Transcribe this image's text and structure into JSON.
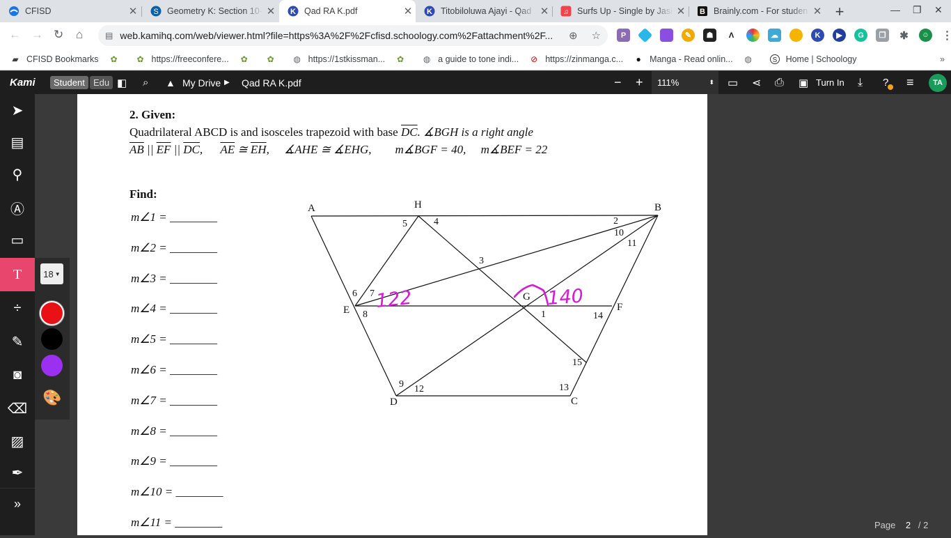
{
  "browser": {
    "tabs": [
      {
        "title": "CFISD",
        "active": false,
        "favicon": "cfisd-icon",
        "color": "#1a73e8"
      },
      {
        "title": "Geometry K: Section 10-",
        "active": false,
        "favicon": "schoology-icon",
        "color": "#0b5ea8"
      },
      {
        "title": "Qad RA K.pdf",
        "active": true,
        "favicon": "kami-icon",
        "color": "#2d4bb0"
      },
      {
        "title": "Titobiloluwa Ajayi - Qad",
        "active": false,
        "favicon": "kami-icon",
        "color": "#2d4bb0"
      },
      {
        "title": "Surfs Up - Single by Jasi",
        "active": false,
        "favicon": "music-icon",
        "color": "#f2434b"
      },
      {
        "title": "Brainly.com - For studen",
        "active": false,
        "favicon": "brainly-icon",
        "color": "#111"
      }
    ],
    "url": "web.kamihq.com/web/viewer.html?file=https%3A%2F%2Fcfisd.schoology.com%2Fattachment%2F...",
    "bookmarks": [
      {
        "label": "CFISD Bookmarks",
        "icon": "folder-icon"
      },
      {
        "label": "",
        "icon": "frog-icon"
      },
      {
        "label": "https://freeconfere...",
        "icon": "frog-icon"
      },
      {
        "label": "",
        "icon": "frog-icon"
      },
      {
        "label": "",
        "icon": "frog-icon"
      },
      {
        "label": "https://1stkissman...",
        "icon": "globe-icon"
      },
      {
        "label": "",
        "icon": "frog-icon"
      },
      {
        "label": "a guide to tone indi...",
        "icon": "globe-icon"
      },
      {
        "label": "https://zinmanga.c...",
        "icon": "zinmanga-icon"
      },
      {
        "label": "Manga - Read onlin...",
        "icon": "sf-icon"
      },
      {
        "label": "",
        "icon": "globe-icon"
      },
      {
        "label": "Home | Schoology",
        "icon": "schoology-icon"
      }
    ]
  },
  "kami": {
    "logo": "Kami",
    "mode_student": "Student",
    "mode_edu": "Edu",
    "drive": "My Drive",
    "filename": "Qad RA K.pdf",
    "zoom": "111%",
    "turn_in": "Turn In",
    "avatar": "TA",
    "font_size": "18",
    "swatches": [
      "#e81216",
      "#000000",
      "#9b30f0"
    ],
    "page_label": "Page",
    "page_current": "2",
    "page_total": "/ 2"
  },
  "worksheet": {
    "heading": "2. Given:",
    "line1_pre": "Quadrilateral ABCD is and isosceles trapezoid with base",
    "line1_base": "DC",
    "line1_post": ". ∡BGH is a right angle",
    "given_parallel": [
      "AB",
      "EF",
      "DC"
    ],
    "given_congruent": [
      "AE",
      "EH"
    ],
    "given_angles": "∡AHE ≅ ∡EHG,",
    "given_bgf": "m∡BGF = 40,",
    "given_bef": "m∡BEF = 22",
    "find_heading": "Find:",
    "find_items": [
      "m∠1 = ________",
      "m∠2 = ________",
      "m∠3 = ________",
      "m∠4 = ________",
      "m∠5 = ________",
      "m∠6 = ________",
      "m∠7 = ________",
      "m∠8 = ________",
      "m∠9 = ________",
      "m∠10 = ________",
      "m∠11 = ________"
    ],
    "points": [
      "A",
      "H",
      "B",
      "E",
      "G",
      "F",
      "D",
      "C"
    ],
    "angle_numbers": [
      "1",
      "2",
      "3",
      "4",
      "5",
      "6",
      "7",
      "8",
      "9",
      "10",
      "11",
      "12",
      "13",
      "14",
      "15"
    ],
    "handwritten_1": "122",
    "handwritten_2": "140"
  }
}
